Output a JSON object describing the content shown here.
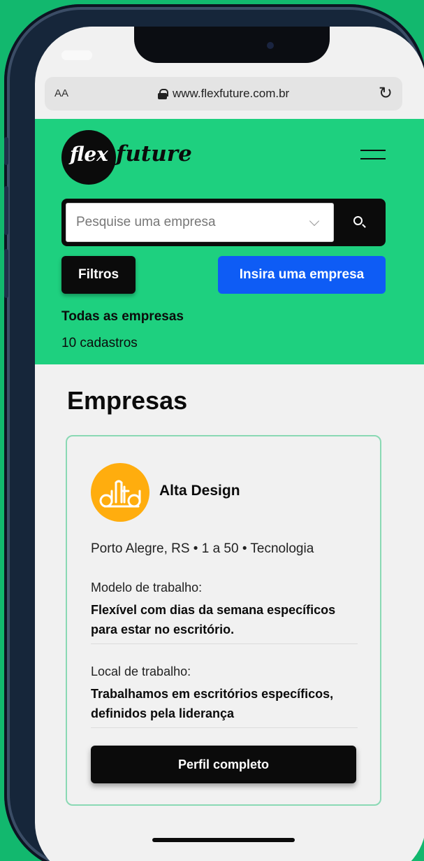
{
  "browser": {
    "text_size_label": "AA",
    "url": "www.flexfuture.com.br"
  },
  "header": {
    "logo_part1": "flex",
    "logo_part2": "future",
    "search_placeholder": "Pesquise uma empresa",
    "filters_label": "Filtros",
    "insert_company_label": "Insira uma empresa",
    "all_companies_label": "Todas as empresas",
    "count_label": "10 cadastros"
  },
  "main": {
    "section_title": "Empresas",
    "company": {
      "name": "Alta Design",
      "logo_text": "alta",
      "meta": "Porto Alegre, RS • 1 a 50 • Tecnologia",
      "work_model_label": "Modelo de trabalho:",
      "work_model_value": "Flexível com dias da semana específicos para estar no escritório.",
      "work_place_label": "Local de trabalho:",
      "work_place_value": "Trabalhamos em escritórios específicos, definidos pela liderança",
      "profile_button": "Perfil completo"
    }
  },
  "colors": {
    "background": "#12b86e",
    "header_green": "#1ed07f",
    "primary_blue": "#0e5cf5",
    "logo_orange": "#ffad0e"
  }
}
